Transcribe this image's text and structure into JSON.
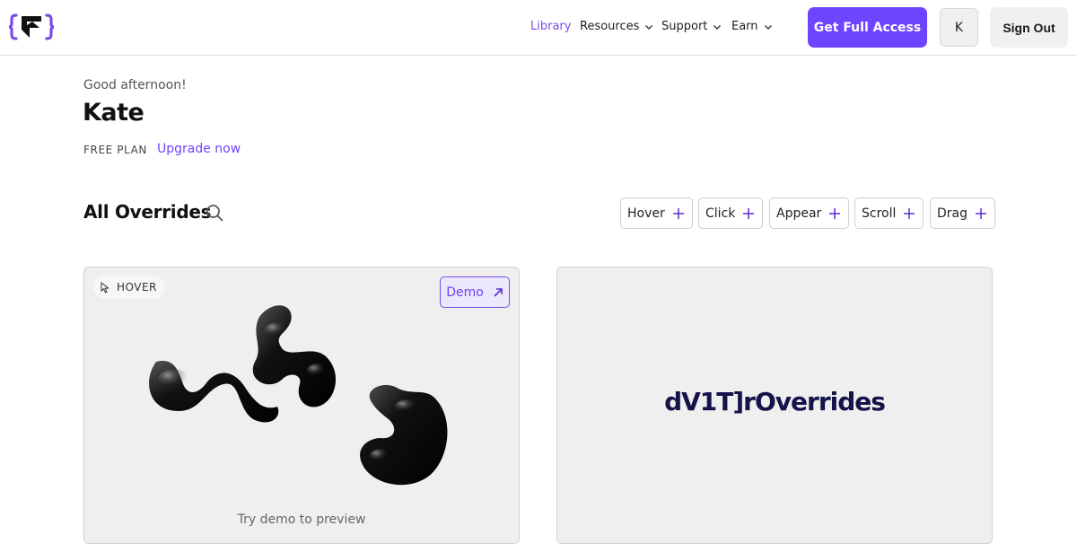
{
  "header": {
    "nav": [
      {
        "label": "Library",
        "active": true,
        "dropdown": false
      },
      {
        "label": "Resources",
        "active": false,
        "dropdown": true
      },
      {
        "label": "Support",
        "active": false,
        "dropdown": true
      },
      {
        "label": "Earn",
        "active": false,
        "dropdown": true
      }
    ],
    "get_access_label": "Get Full Access",
    "avatar_initial": "K",
    "sign_out_label": "Sign Out",
    "accent_color": "#6e44ff"
  },
  "greeting": {
    "salutation": "Good afternoon!",
    "name": "Kate",
    "plan": "FREE PLAN",
    "upgrade_label": "Upgrade now"
  },
  "overrides": {
    "title": "All Overrides",
    "filters": [
      "Hover",
      "Click",
      "Appear",
      "Scroll",
      "Drag"
    ]
  },
  "cards": [
    {
      "tag": "HOVER",
      "tag_icon": "cursor-icon",
      "demo_label": "Demo",
      "caption": "Try demo to preview"
    },
    {
      "brand_text": "dV1T]rOverrides"
    }
  ]
}
